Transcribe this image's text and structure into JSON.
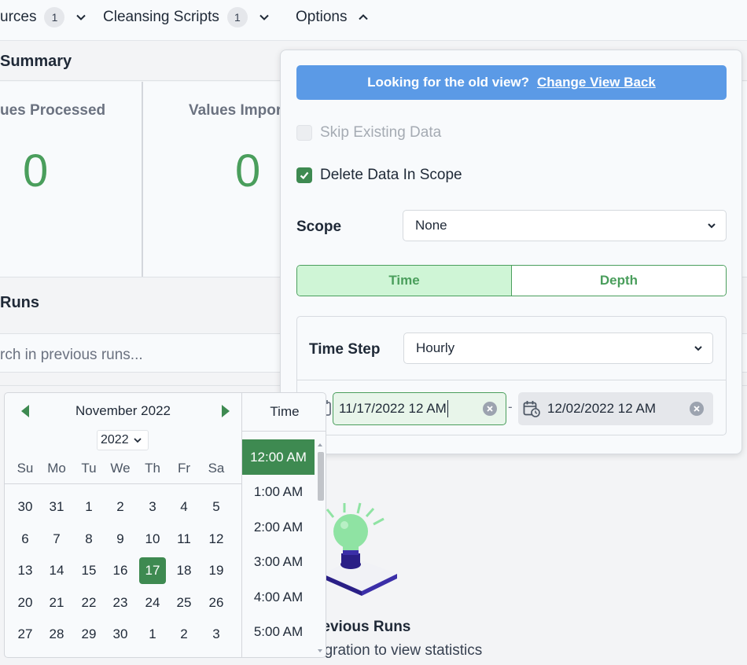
{
  "nav": {
    "sources_label": "urces",
    "sources_count": "1",
    "cleansing_label": "Cleansing Scripts",
    "cleansing_count": "1",
    "options_label": "Options"
  },
  "summary": {
    "title": "Summary",
    "processed_label": "ues Processed",
    "processed_value": "0",
    "imported_label": "Values Impor",
    "imported_value": "0"
  },
  "runs": {
    "title": "Runs",
    "search_placeholder": "rch in previous runs...",
    "empty_title": "revious Runs",
    "empty_subtitle": "egration to view statistics"
  },
  "options": {
    "old_view_text": "Looking for the old view?",
    "old_view_link": "Change View Back",
    "skip_existing_label": "Skip Existing Data",
    "skip_existing_checked": false,
    "delete_scope_label": "Delete Data In Scope",
    "delete_scope_checked": true,
    "scope_label": "Scope",
    "scope_value": "None",
    "seg_time": "Time",
    "seg_depth": "Depth",
    "time_step_label": "Time Step",
    "time_step_value": "Hourly",
    "start_date": "11/17/2022 12 AM",
    "separator": "-",
    "end_date": "12/02/2022 12 AM"
  },
  "calendar": {
    "month": "November 2022",
    "year": "2022",
    "time_header": "Time",
    "weekdays": [
      "Su",
      "Mo",
      "Tu",
      "We",
      "Th",
      "Fr",
      "Sa"
    ],
    "weeks": [
      [
        "30",
        "31",
        "1",
        "2",
        "3",
        "4",
        "5"
      ],
      [
        "6",
        "7",
        "8",
        "9",
        "10",
        "11",
        "12"
      ],
      [
        "13",
        "14",
        "15",
        "16",
        "17",
        "18",
        "19"
      ],
      [
        "20",
        "21",
        "22",
        "23",
        "24",
        "25",
        "26"
      ],
      [
        "27",
        "28",
        "29",
        "30",
        "1",
        "2",
        "3"
      ]
    ],
    "selected_day": "17",
    "times": [
      "12:00 AM",
      "1:00 AM",
      "2:00 AM",
      "3:00 AM",
      "4:00 AM",
      "5:00 AM"
    ],
    "selected_time": "12:00 AM"
  },
  "colors": {
    "accent_green": "#3e8a51",
    "stat_green": "#4a9e5c",
    "banner_blue": "#5b9ae6"
  }
}
